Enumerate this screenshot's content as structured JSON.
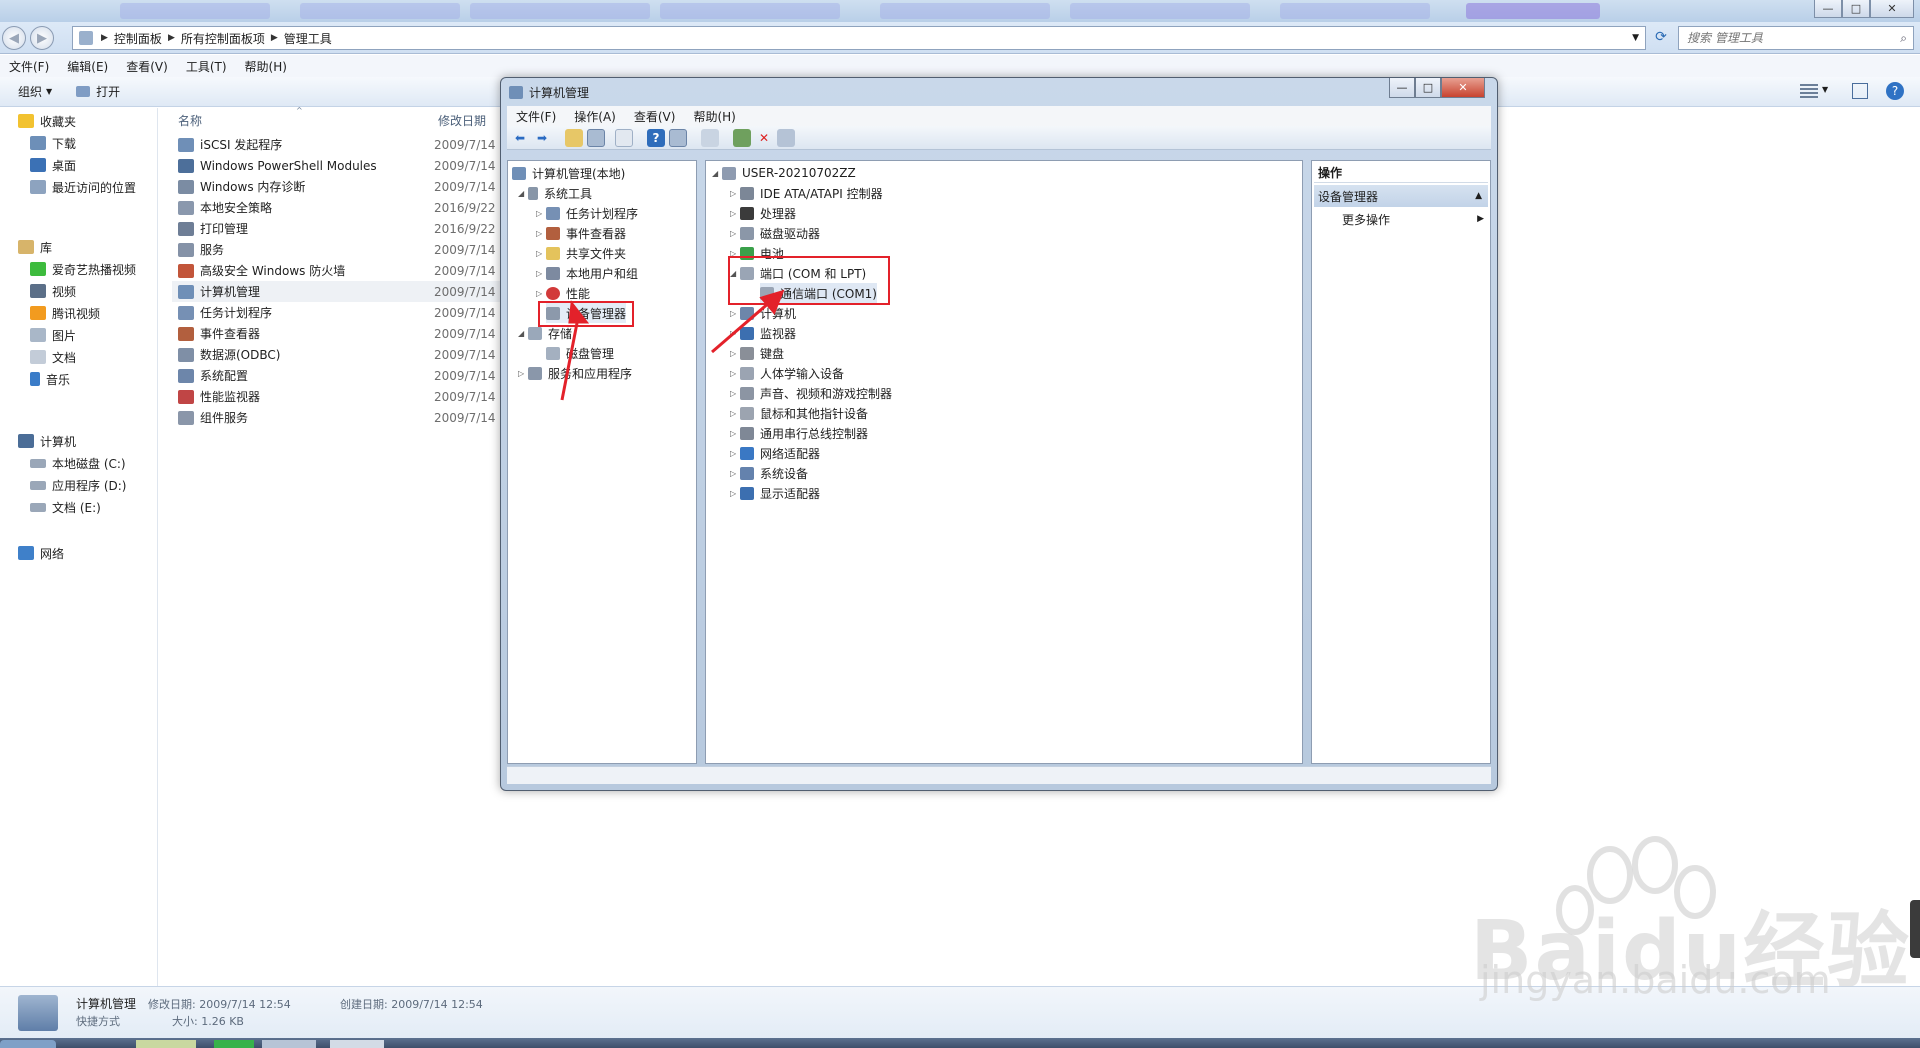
{
  "explorer": {
    "address": [
      "控制面板",
      "所有控制面板项",
      "管理工具"
    ],
    "search_placeholder": "搜索 管理工具",
    "menu": [
      "文件(F)",
      "编辑(E)",
      "查看(V)",
      "工具(T)",
      "帮助(H)"
    ],
    "commands": {
      "organize": "组织",
      "open": "打开"
    },
    "nav": {
      "favorites": "收藏夹",
      "fav_items": [
        "下载",
        "桌面",
        "最近访问的位置"
      ],
      "libraries": "库",
      "lib_items": [
        "爱奇艺热播视频",
        "视频",
        "腾讯视频",
        "图片",
        "文档",
        "音乐"
      ],
      "computer": "计算机",
      "drives": [
        "本地磁盘 (C:)",
        "应用程序 (D:)",
        "文档 (E:)"
      ],
      "network": "网络"
    },
    "columns": {
      "name": "名称",
      "modified": "修改日期"
    },
    "files": [
      {
        "name": "iSCSI 发起程序",
        "date": "2009/7/14"
      },
      {
        "name": "Windows PowerShell Modules",
        "date": "2009/7/14"
      },
      {
        "name": "Windows 内存诊断",
        "date": "2009/7/14"
      },
      {
        "name": "本地安全策略",
        "date": "2016/9/22"
      },
      {
        "name": "打印管理",
        "date": "2016/9/22"
      },
      {
        "name": "服务",
        "date": "2009/7/14"
      },
      {
        "name": "高级安全 Windows 防火墙",
        "date": "2009/7/14"
      },
      {
        "name": "计算机管理",
        "date": "2009/7/14"
      },
      {
        "name": "任务计划程序",
        "date": "2009/7/14"
      },
      {
        "name": "事件查看器",
        "date": "2009/7/14"
      },
      {
        "name": "数据源(ODBC)",
        "date": "2009/7/14"
      },
      {
        "name": "系统配置",
        "date": "2009/7/14"
      },
      {
        "name": "性能监视器",
        "date": "2009/7/14"
      },
      {
        "name": "组件服务",
        "date": "2009/7/14"
      }
    ],
    "details": {
      "name": "计算机管理",
      "type": "快捷方式",
      "modified": "修改日期: 2009/7/14 12:54",
      "created": "创建日期: 2009/7/14 12:54",
      "size": "大小: 1.26 KB"
    }
  },
  "cm": {
    "title": "计算机管理",
    "menu": [
      "文件(F)",
      "操作(A)",
      "查看(V)",
      "帮助(H)"
    ],
    "left_tree": {
      "root": "计算机管理(本地)",
      "system_tools": "系统工具",
      "tools": [
        "任务计划程序",
        "事件查看器",
        "共享文件夹",
        "本地用户和组",
        "性能",
        "设备管理器"
      ],
      "storage": "存储",
      "disk_mgmt": "磁盘管理",
      "services": "服务和应用程序"
    },
    "device_tree": {
      "computer": "USER-20210702ZZ",
      "categories": [
        "IDE ATA/ATAPI 控制器",
        "处理器",
        "磁盘驱动器",
        "电池",
        "端口 (COM 和 LPT)",
        "计算机",
        "监视器",
        "键盘",
        "人体学输入设备",
        "声音、视频和游戏控制器",
        "鼠标和其他指针设备",
        "通用串行总线控制器",
        "网络适配器",
        "系统设备",
        "显示适配器"
      ],
      "port_child": "通信端口 (COM1)"
    },
    "actions": {
      "header": "操作",
      "section": "设备管理器",
      "more": "更多操作"
    }
  },
  "watermark": {
    "brand": "Baidu",
    "sub": "经验",
    "url": "jingyan.baidu.com"
  },
  "colors": {
    "accent": "#e3212a",
    "selection": "#cce4f7",
    "chrome": "#c9d8ea"
  }
}
